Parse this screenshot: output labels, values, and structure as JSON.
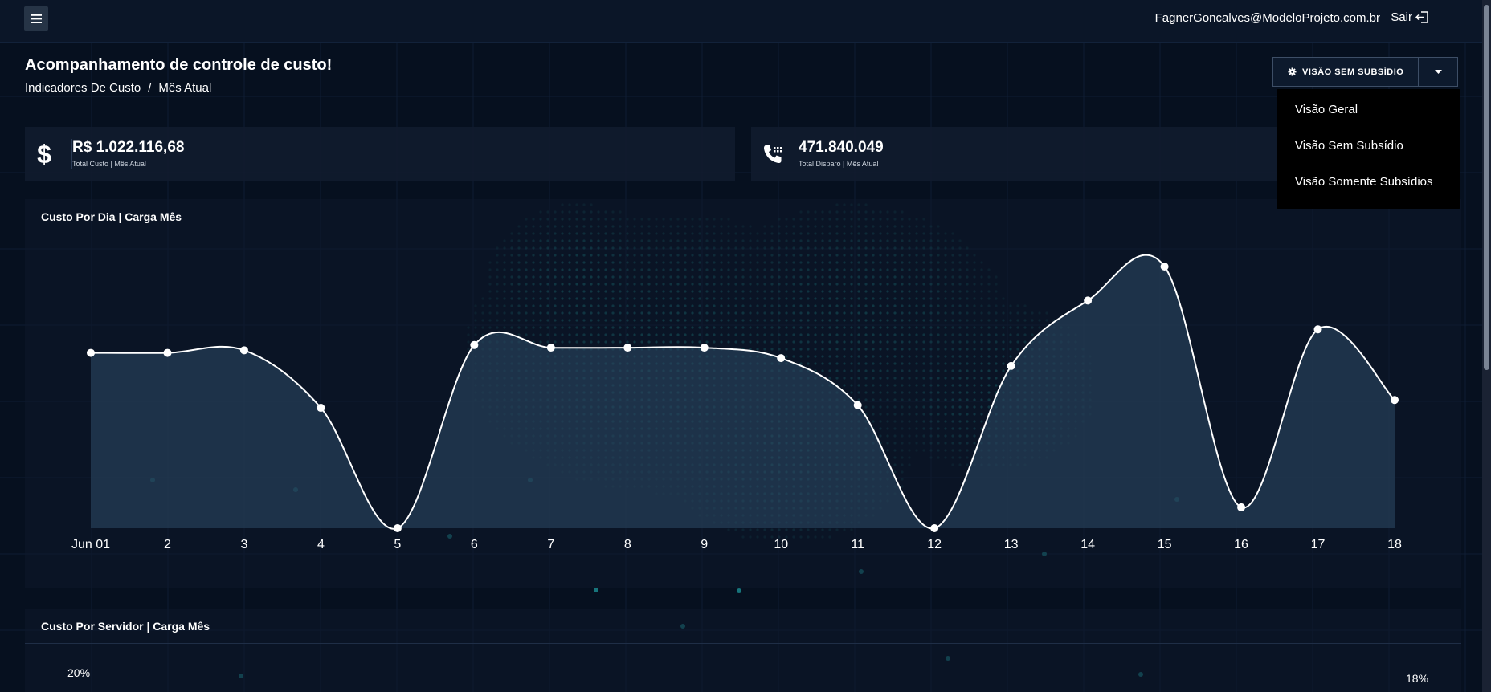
{
  "header": {
    "menu_icon": "hamburger-icon",
    "user_email": "FagnerGoncalves@ModeloProjeto.com.br",
    "logout_label": "Sair",
    "logout_icon": "logout-icon"
  },
  "page": {
    "title": "Acompanhamento de controle de custo!",
    "breadcrumb": [
      "Indicadores De Custo",
      "/",
      "Mês Atual"
    ]
  },
  "view_selector": {
    "label": "VISÃO SEM SUBSÍDIO",
    "icon": "gear-icon",
    "caret_icon": "caret-down-icon",
    "options": [
      "Visão Geral",
      "Visão Sem Subsídio",
      "Visão Somente Subsídios"
    ]
  },
  "stats": [
    {
      "icon": "dollar-icon",
      "value": "R$ 1.022.116,68",
      "label": "Total Custo | Mês Atual"
    },
    {
      "icon": "phone-icon",
      "value": "471.840.049",
      "label": "Total Disparo | Mês Atual"
    }
  ],
  "panels": {
    "daily_cost_title": "Custo Por Dia | Carga Mês",
    "server_cost_title": "Custo Por Servidor | Carga Mês",
    "server_pct_left": "20%",
    "server_pct_right": "18%"
  },
  "colors": {
    "background": "#06101f",
    "line": "#ffffff",
    "area": "#2a4560"
  },
  "chart_data": {
    "type": "area",
    "title": "Custo Por Dia | Carga Mês",
    "xlabel": "",
    "ylabel": "",
    "categories": [
      "Jun 01",
      "2",
      "3",
      "4",
      "5",
      "6",
      "7",
      "8",
      "9",
      "10",
      "11",
      "12",
      "13",
      "14",
      "15",
      "16",
      "17",
      "18"
    ],
    "series": [
      {
        "values": [
          0.67,
          0.67,
          0.68,
          0.46,
          0.0,
          0.7,
          0.69,
          0.69,
          0.69,
          0.65,
          0.47,
          0.0,
          0.62,
          0.87,
          1.0,
          0.08,
          0.76,
          0.49
        ]
      }
    ],
    "ylim": [
      0,
      1
    ],
    "grid": false,
    "legend": "none"
  }
}
